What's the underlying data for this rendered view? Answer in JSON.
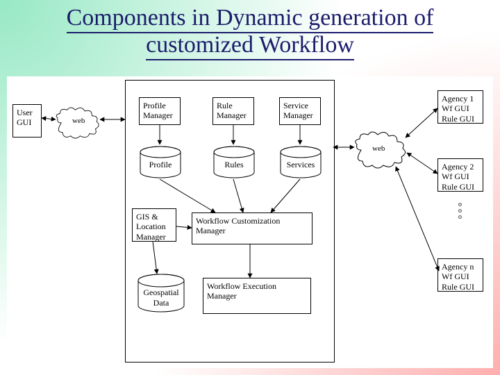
{
  "title_line1": "Components in Dynamic generation of",
  "title_line2": "customized Workflow",
  "user_gui": "User\nGUI",
  "web_left": "web",
  "profile_manager": "Profile\nManager",
  "rule_manager": "Rule\nManager",
  "service_manager": "Service\nManager",
  "profile_db": "Profile",
  "rules_db": "Rules",
  "services_db": "Services",
  "gis": "GIS &\nLocation\nManager",
  "wcm": "Workflow Customization\nManager",
  "geo_db": "Geospatial\nData",
  "wem": "Workflow Execution\nManager",
  "web_right": "web",
  "agency1": "Agency 1\nWf GUI\nRule GUI",
  "agency2": "Agency 2\nWf GUI\nRule GUI",
  "agencyn": "Agency n\nWf GUI\nRule GUI"
}
